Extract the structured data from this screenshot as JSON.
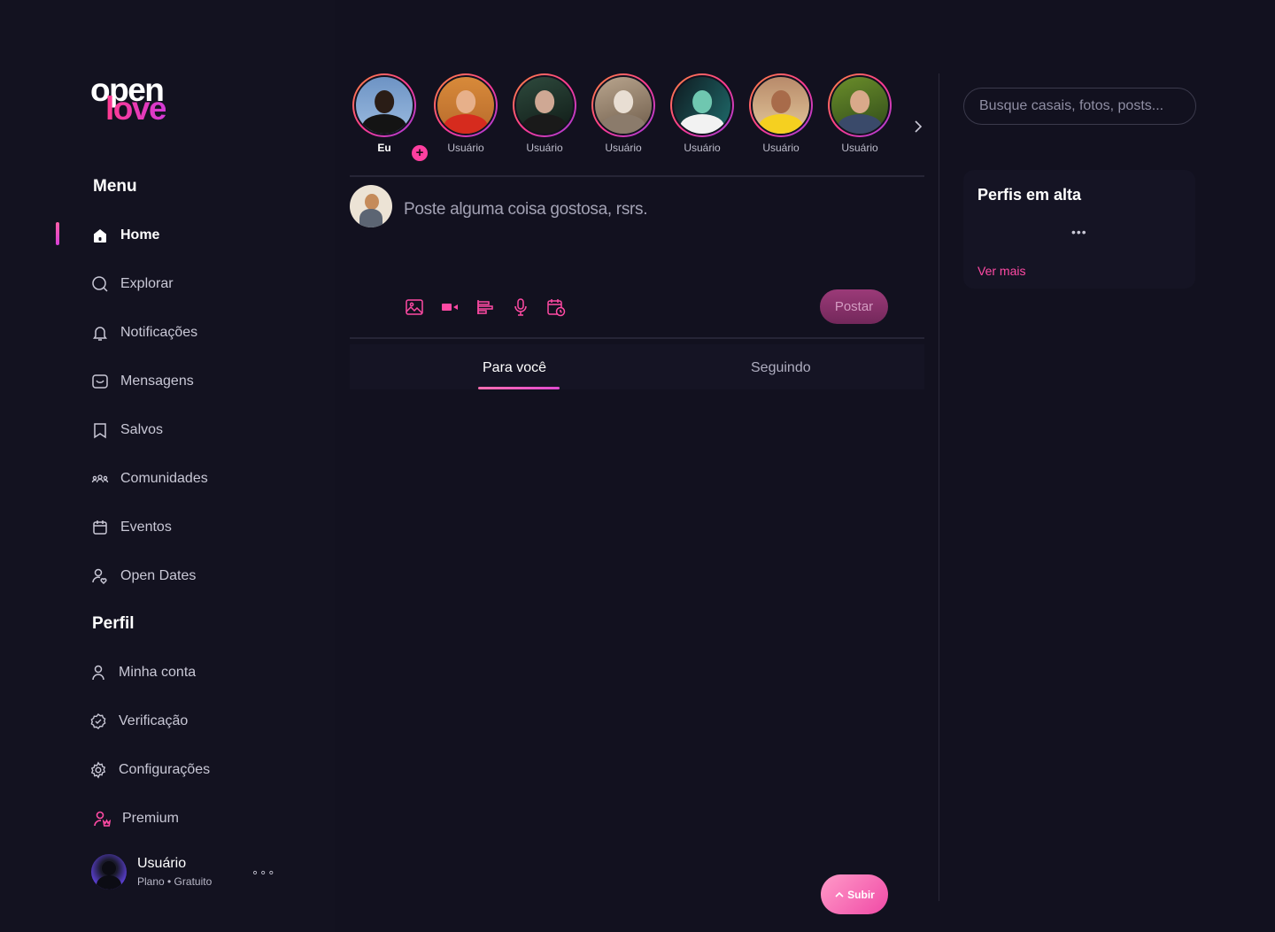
{
  "brand": {
    "line1": "open",
    "line2": "love",
    "accent": "#ff3b8e",
    "accent2": "#d53ad6"
  },
  "menu": {
    "title": "Menu",
    "items": [
      {
        "label": "Home",
        "icon": "home-icon",
        "active": true
      },
      {
        "label": "Explorar",
        "icon": "search-icon"
      },
      {
        "label": "Notificações",
        "icon": "bell-icon"
      },
      {
        "label": "Mensagens",
        "icon": "message-icon"
      },
      {
        "label": "Salvos",
        "icon": "bookmark-icon"
      },
      {
        "label": "Comunidades",
        "icon": "community-icon"
      },
      {
        "label": "Eventos",
        "icon": "calendar-icon"
      },
      {
        "label": "Open Dates",
        "icon": "dates-icon"
      }
    ]
  },
  "profile": {
    "title": "Perfil",
    "items": [
      {
        "label": "Minha conta",
        "icon": "user-icon"
      },
      {
        "label": "Verificação",
        "icon": "verified-icon"
      },
      {
        "label": "Configurações",
        "icon": "gear-icon"
      },
      {
        "label": "Premium",
        "icon": "premium-icon"
      }
    ]
  },
  "user": {
    "name": "Usuário",
    "plan": "Plano • Gratuito",
    "more": "∘∘∘"
  },
  "stories": {
    "items": [
      {
        "label": "Eu",
        "me": true
      },
      {
        "label": "Usuário"
      },
      {
        "label": "Usuário"
      },
      {
        "label": "Usuário"
      },
      {
        "label": "Usuário"
      },
      {
        "label": "Usuário"
      },
      {
        "label": "Usuário"
      }
    ],
    "add": "+",
    "next_icon": "chevron-right-icon"
  },
  "composer": {
    "placeholder": "Poste alguma coisa gostosa, rsrs.",
    "tools": [
      "image-icon",
      "video-icon",
      "poll-icon",
      "microphone-icon",
      "schedule-icon"
    ],
    "post_label": "Postar"
  },
  "feed_tabs": {
    "for_you": "Para você",
    "following": "Seguindo"
  },
  "scroll_top": {
    "label": "Subir",
    "icon": "chevron-up-icon"
  },
  "search": {
    "placeholder": "Busque casais, fotos, posts..."
  },
  "trending": {
    "title": "Perfis em alta",
    "dots": "•••",
    "more": "Ver mais"
  }
}
